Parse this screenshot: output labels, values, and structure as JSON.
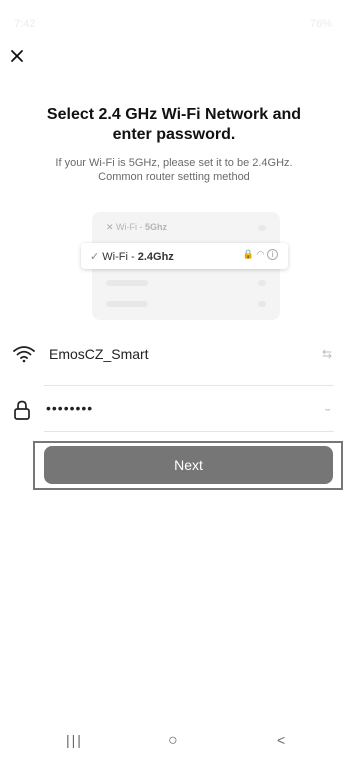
{
  "status_bar": {
    "time": "7:42",
    "indicators": "76%"
  },
  "header": {
    "close_icon": "close-icon"
  },
  "content": {
    "title": "Select 2.4 GHz Wi-Fi Network and enter password.",
    "subtitle": "If your Wi-Fi is 5GHz, please set it to be 2.4GHz. Common router setting method"
  },
  "illustration": {
    "row1_prefix": "Wi-Fi - ",
    "row1_band": "5Ghz",
    "row2_prefix": "Wi-Fi - ",
    "row2_band": "2.4Ghz"
  },
  "form": {
    "wifi_name": "EmosCZ_Smart",
    "password_masked": "••••••••"
  },
  "actions": {
    "next_label": "Next"
  },
  "nav": {
    "recents": "|||",
    "home": "○",
    "back": "<"
  }
}
